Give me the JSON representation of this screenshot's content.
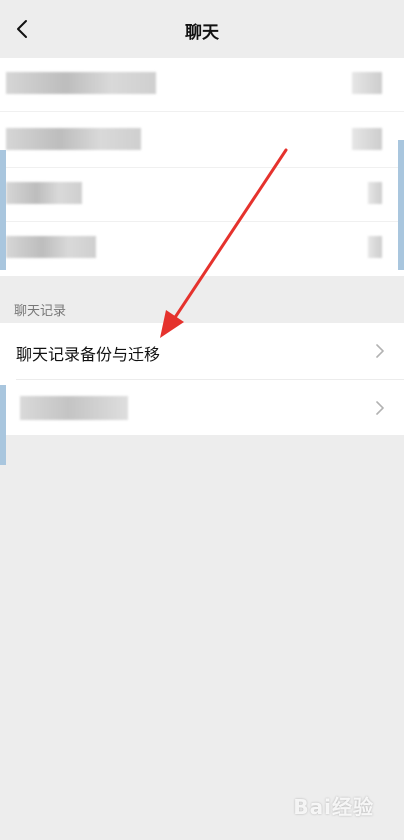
{
  "header": {
    "title": "聊天"
  },
  "section": {
    "label": "聊天记录"
  },
  "settings": {
    "items": [
      {
        "label": "聊天记录备份与迁移"
      }
    ]
  },
  "watermark": {
    "text": "Bai经验"
  },
  "colors": {
    "arrow": "#e5322d",
    "accent_strip": "#a9c6de"
  }
}
